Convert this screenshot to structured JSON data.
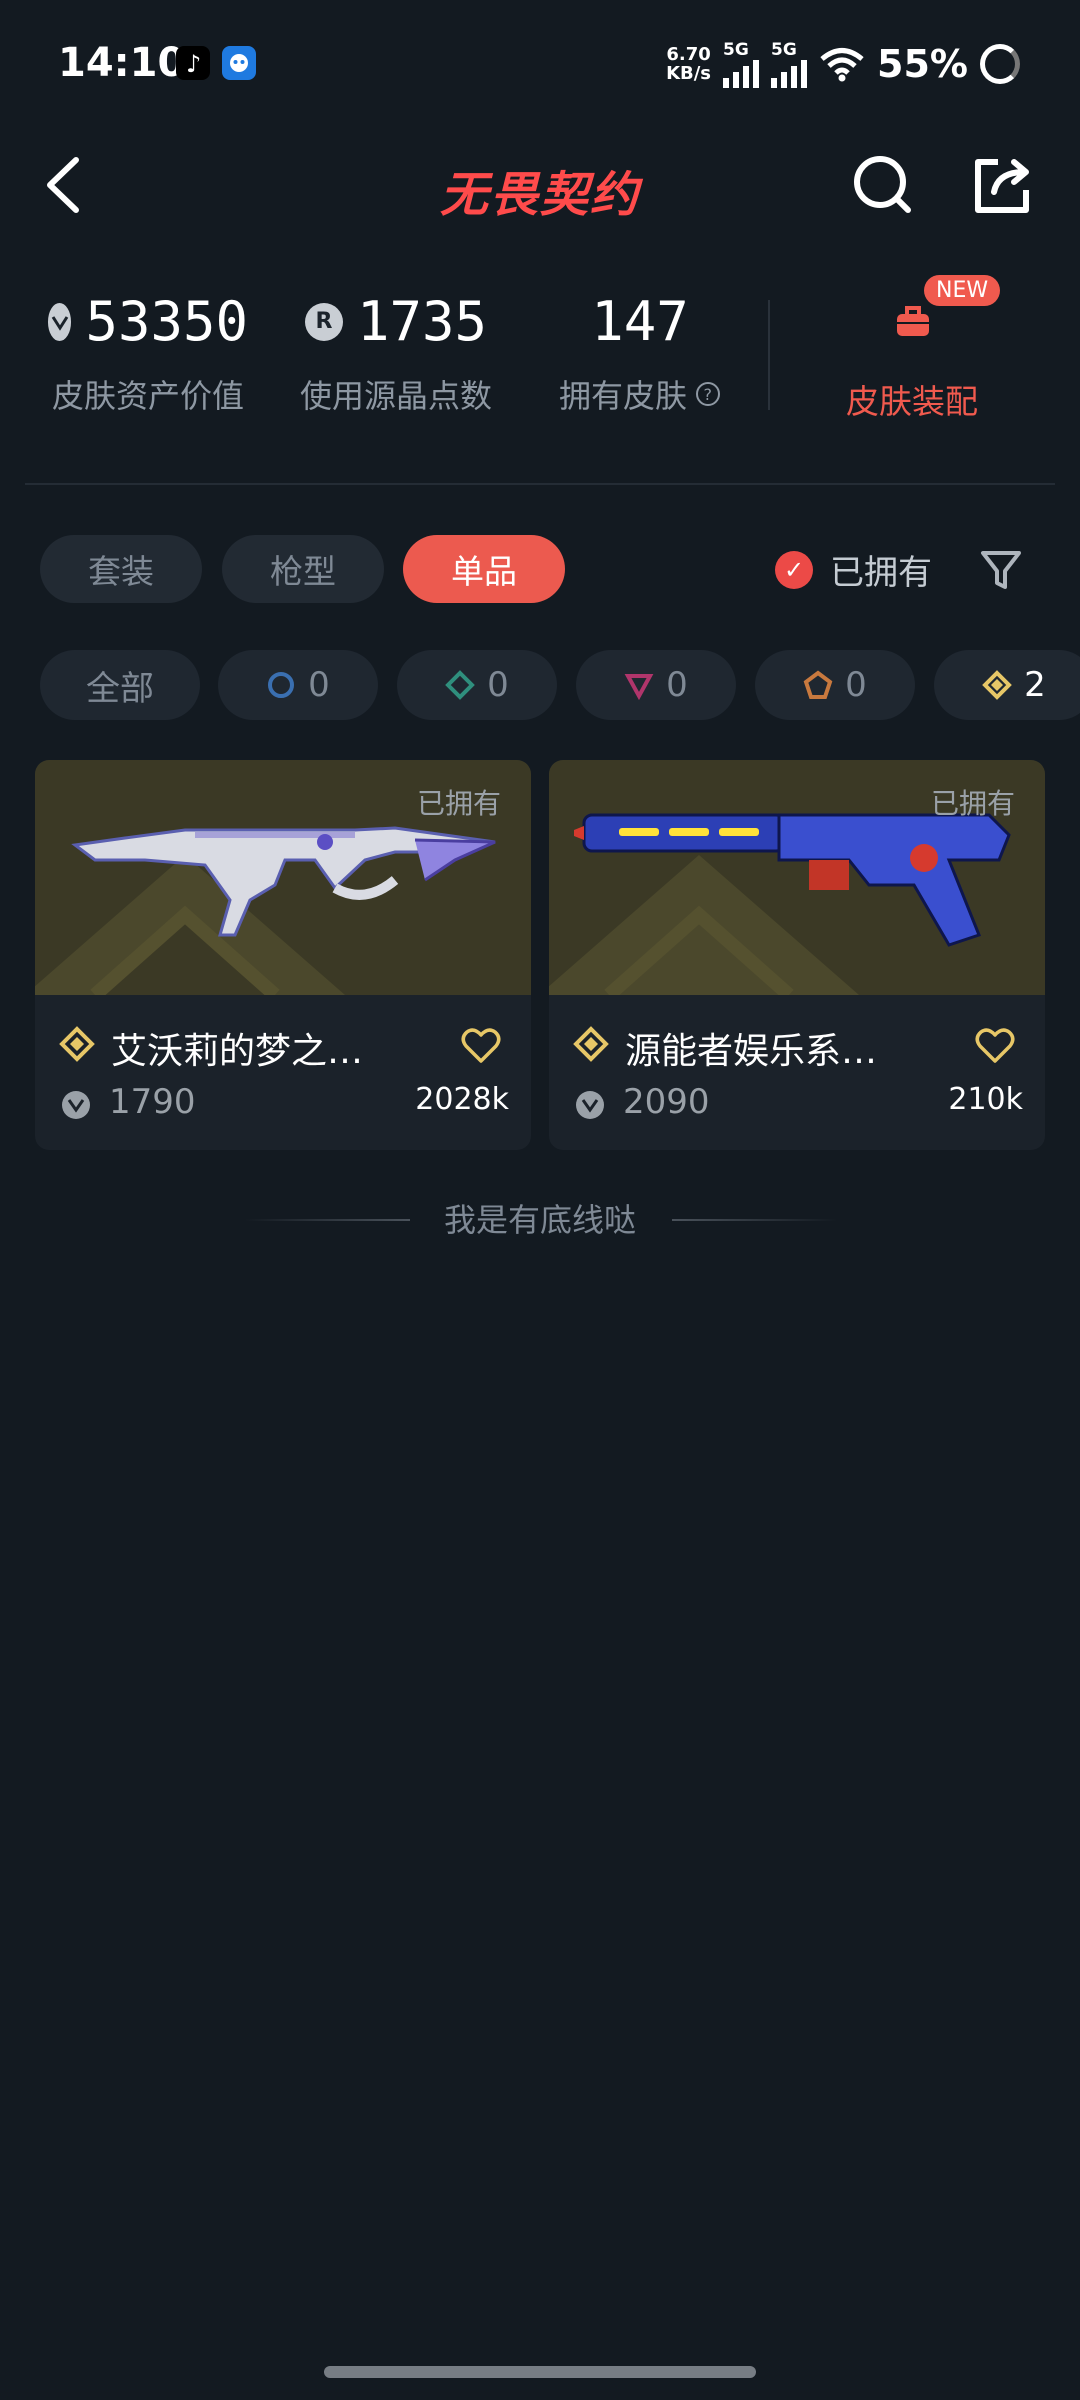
{
  "status_bar": {
    "time": "14:10",
    "speed_top": "6.70",
    "speed_bottom": "KB/s",
    "net1": "5G",
    "net2": "5G",
    "battery": "55%"
  },
  "header": {
    "title": "无畏契约",
    "icons": [
      "back-icon",
      "search-icon",
      "share-icon"
    ]
  },
  "stats": {
    "asset_value": "53350",
    "asset_label": "皮肤资产价值",
    "points": "1735",
    "points_label": "使用源晶点数",
    "points_coin": "R",
    "skins": "147",
    "skins_label": "拥有皮肤",
    "new_badge": "NEW",
    "outfit_label": "皮肤装配"
  },
  "tabs": {
    "items": [
      "套装",
      "枪型",
      "单品"
    ],
    "active": "单品",
    "owned_filter": "已拥有"
  },
  "rarity_chips": [
    {
      "label": "全部"
    },
    {
      "count": "0",
      "tier": "select",
      "color": "#3a6fb0"
    },
    {
      "count": "0",
      "tier": "deluxe",
      "color": "#2f8f7d"
    },
    {
      "count": "0",
      "tier": "premium",
      "color": "#b0356b"
    },
    {
      "count": "0",
      "tier": "exclusive",
      "color": "#c8793e"
    },
    {
      "count": "2",
      "tier": "ultra",
      "color": "#e7c767"
    }
  ],
  "cards": [
    {
      "name": "艾沃莉的梦之…",
      "owned": "已拥有",
      "price": "1790",
      "count": "2028k"
    },
    {
      "name": "源能者娱乐系…",
      "owned": "已拥有",
      "price": "2090",
      "count": "210k"
    }
  ],
  "footer": {
    "bottom_text": "我是有底线哒"
  }
}
